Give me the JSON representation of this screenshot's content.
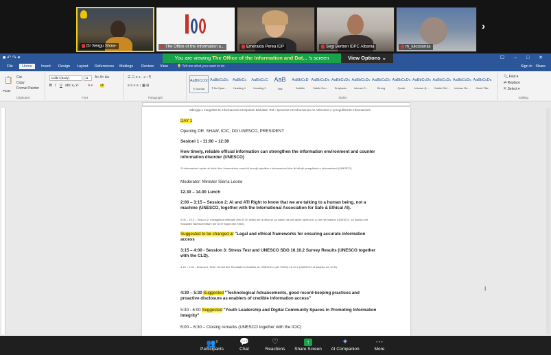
{
  "participants_strip": [
    {
      "name": "Dr Seagu Shaw-"
    },
    {
      "name": "The Office of the Information a..."
    },
    {
      "name": "Emeralda Perea IDP"
    },
    {
      "name": "Segi Berberi IDPC Albania"
    },
    {
      "name": "m_lukosiunas"
    }
  ],
  "share_banner": {
    "prefix": "You are viewing",
    "presenter": "The Office of the Information and Dat...",
    "suffix": "'s screen",
    "view_options": "View Options"
  },
  "word": {
    "quick_access": "■ ↶ ↷ ▾",
    "window_buttons": "☐ – □ ✕",
    "tabs": [
      "File",
      "Home",
      "Insert",
      "Design",
      "Layout",
      "References",
      "Mailings",
      "Review",
      "View"
    ],
    "active_tab": "Home",
    "tell_me": "Tell me what you want to do",
    "sign_in": "Sign in",
    "share": "Share",
    "ribbon": {
      "paste": "Paste",
      "cut": "Cut",
      "copy": "Copy",
      "format_painter": "Format Painter",
      "clipboard": "Clipboard",
      "font_name": "Calibri (Body)",
      "font_size": "11",
      "font": "Font",
      "paragraph": "Paragraph",
      "styles_label": "Styles",
      "editing": "Editing",
      "find": "Find",
      "replace": "Replace",
      "select": "Select",
      "styles": [
        {
          "sample": "AaBbCcDc",
          "name": "¶ Normal"
        },
        {
          "sample": "AaBbCcDc",
          "name": "¶ No Spac..."
        },
        {
          "sample": "AaBbCc",
          "name": "Heading 1"
        },
        {
          "sample": "AaBbCcC",
          "name": "Heading 2"
        },
        {
          "sample": "AaB",
          "name": "Title"
        },
        {
          "sample": "AaBbCcD",
          "name": "Subtitle"
        },
        {
          "sample": "AaBbCcDc",
          "name": "Subtle Em..."
        },
        {
          "sample": "AaBbCcDc",
          "name": "Emphasis"
        },
        {
          "sample": "AaBbCcDc",
          "name": "Intense E..."
        },
        {
          "sample": "AaBbCcDc",
          "name": "Strong"
        },
        {
          "sample": "AaBbCcDc",
          "name": "Quote"
        },
        {
          "sample": "AaBbCcDc",
          "name": "Intense Q..."
        },
        {
          "sample": "AaBbCcDc",
          "name": "Subtle Ref..."
        },
        {
          "sample": "AaBbCcDc",
          "name": "Intense Re..."
        },
        {
          "sample": "AaBbCcDc",
          "name": "Book Title"
        }
      ]
    },
    "doc": {
      "header": "Mbrojtja e integritetit të Informacionit në Epokën Dixhitale: Roli i Qeverisë në Informacion në Adresimin e Çrregullimit të Informacionit",
      "day": "DAY 1",
      "opening": "Opening DR. SHAW, ICIC, DG UNESCO, PRESIDENT",
      "session1": "Sesioni 1 - 11:00 – 12:30",
      "session1_title": "How timely, reliable official information can strengthen the information environment and counter information disorder (UNESCO)",
      "session1_sq": "Si informacioni zyrtar në kohë dhe i besueshëm mund të forcojë mjedisin e informacionit dhe të luftojë çrregullimin e informacionit (UNESCO)",
      "moderator": "Moderator: Minister Sierra Leone",
      "lunch": "12.30 – 14.00 Lunch",
      "session2": "2:00 – 3:15 – Session 2: AI and ATI Right to know that we are talking to a human being, not a machine (UNESCO, together with the International Association for Safe & Ethical AI).",
      "session2_sq": "2:00 – 3:15 – Sesioni 2: Inteligjenca artificiale dhe ATI E drejta për të ditur se po flasim me një qenie njerëzore, jo me një makinë (UNESCO, së bashku me Shoqatën Ndërkombëtare për AI të Sigurt dhe Etike).",
      "suggested1_hl": "Suggested to be changed at",
      "suggested1_text": " \"Legal and ethical frameworks for ensuring accurate information access",
      "session3": "3:15 – 4:00 - Session 3: Stress Test and UNESCO SDG 16.10.2 Survey Results  (UNESCO together with the CLD).",
      "session3_sq": "3:15 – 4:00 - Sesioni 3: Testi i Stresit dhe Rezultatet e Anketës së UNESCO-s për ODHQ 16.10.2 (UNESCO së bashku me CLD).",
      "s4_time": "4:30 – 5:30 ",
      "s4_hl": "Suggested",
      "s4_text": "  \"Technological Advancements, good record-keeping practices and proactive disclosure as enablers of credible information access\"",
      "s5_time": "5:30 - 6:00  ",
      "s5_hl": "Suggested",
      "s5_text": "  \"Youth Leadership and Digital Community Spaces in Promoting Information Integrity\"",
      "closing": "6:00 – 6:30 – Closing remarks (UNESCO together with the ICIC)"
    }
  },
  "zoom_toolbar": [
    {
      "label": "Participants",
      "icon": "participants-icon",
      "glyph": "👥",
      "count": "9"
    },
    {
      "label": "Chat",
      "icon": "chat-icon",
      "glyph": "💬"
    },
    {
      "label": "Reactions",
      "icon": "reactions-icon",
      "glyph": "♡"
    },
    {
      "label": "Share Screen",
      "icon": "share-screen-icon",
      "glyph": "↑"
    },
    {
      "label": "AI Companion",
      "icon": "ai-companion-icon",
      "glyph": "✦"
    },
    {
      "label": "More",
      "icon": "more-icon",
      "glyph": "⋯"
    }
  ]
}
